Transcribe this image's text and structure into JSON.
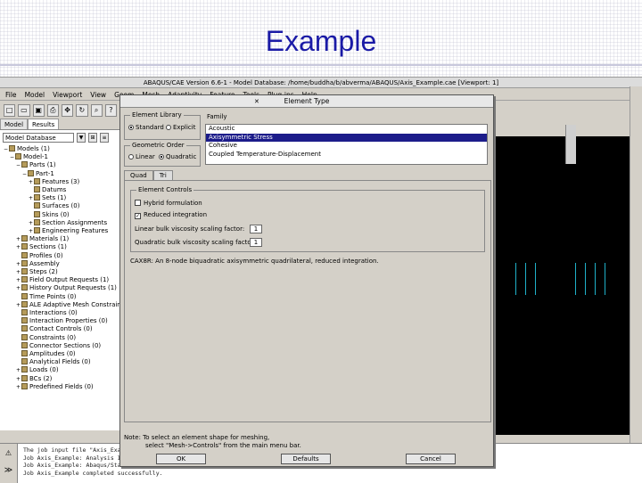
{
  "slide": {
    "title": "Example"
  },
  "app": {
    "window_title": "ABAQUS/CAE Version 6.6-1 - Model Database: /home/buddha/b/abverma/ABAQUS/Axis_Example.cae [Viewport: 1]",
    "menu": [
      "File",
      "Model",
      "Viewport",
      "View",
      "Geom",
      "Mesh",
      "Adaptivity",
      "Feature",
      "Tools",
      "Plug-ins",
      "Help"
    ],
    "toolbar_icons": [
      "new-icon",
      "open-icon",
      "save-icon",
      "print-icon",
      "move-icon",
      "rotate-icon",
      "zoom-icon",
      "query-icon"
    ],
    "tree_tabs": [
      "Model",
      "Results"
    ],
    "tree_combo": "Model Database",
    "tree": [
      {
        "label": "Models (1)",
        "indent": 0,
        "exp": "−"
      },
      {
        "label": "Model-1",
        "indent": 1,
        "exp": "−"
      },
      {
        "label": "Parts (1)",
        "indent": 2,
        "exp": "−"
      },
      {
        "label": "Part-1",
        "indent": 3,
        "exp": "−"
      },
      {
        "label": "Features (3)",
        "indent": 4,
        "exp": "+"
      },
      {
        "label": "Datums",
        "indent": 4,
        "exp": ""
      },
      {
        "label": "Sets (1)",
        "indent": 4,
        "exp": "+"
      },
      {
        "label": "Surfaces (0)",
        "indent": 4,
        "exp": ""
      },
      {
        "label": "Skins (0)",
        "indent": 4,
        "exp": ""
      },
      {
        "label": "Section Assignments",
        "indent": 4,
        "exp": "+"
      },
      {
        "label": "Engineering Features",
        "indent": 4,
        "exp": "+"
      },
      {
        "label": "Materials (1)",
        "indent": 2,
        "exp": "+"
      },
      {
        "label": "Sections (1)",
        "indent": 2,
        "exp": "+"
      },
      {
        "label": "Profiles (0)",
        "indent": 2,
        "exp": ""
      },
      {
        "label": "Assembly",
        "indent": 2,
        "exp": "+"
      },
      {
        "label": "Steps (2)",
        "indent": 2,
        "exp": "+"
      },
      {
        "label": "Field Output Requests (1)",
        "indent": 2,
        "exp": "+"
      },
      {
        "label": "History Output Requests (1)",
        "indent": 2,
        "exp": "+"
      },
      {
        "label": "Time Points (0)",
        "indent": 2,
        "exp": ""
      },
      {
        "label": "ALE Adaptive Mesh Constraints",
        "indent": 2,
        "exp": "+"
      },
      {
        "label": "Interactions (0)",
        "indent": 2,
        "exp": ""
      },
      {
        "label": "Interaction Properties (0)",
        "indent": 2,
        "exp": ""
      },
      {
        "label": "Contact Controls (0)",
        "indent": 2,
        "exp": ""
      },
      {
        "label": "Constraints (0)",
        "indent": 2,
        "exp": ""
      },
      {
        "label": "Connector Sections (0)",
        "indent": 2,
        "exp": ""
      },
      {
        "label": "Amplitudes (0)",
        "indent": 2,
        "exp": ""
      },
      {
        "label": "Analytical Fields (0)",
        "indent": 2,
        "exp": ""
      },
      {
        "label": "Loads (0)",
        "indent": 2,
        "exp": "+"
      },
      {
        "label": "BCs (2)",
        "indent": 2,
        "exp": "+"
      },
      {
        "label": "Predefined Fields (0)",
        "indent": 2,
        "exp": "+"
      }
    ],
    "messages": [
      "The job input file \"Axis_Example.inp\" has been submitted for analysis.",
      "Job Axis_Example: Analysis Input File Processor completed successfully.",
      "Job Axis_Example: Abaqus/Standard completed successfully.",
      "Job Axis_Example completed successfully."
    ],
    "prompt_symbol": "≫"
  },
  "dialog": {
    "title": "Element Type",
    "library": {
      "label": "Element Library",
      "options": [
        "Standard",
        "Explicit"
      ],
      "selected": "Standard"
    },
    "order": {
      "label": "Geometric Order",
      "options": [
        "Linear",
        "Quadratic"
      ],
      "selected": "Quadratic"
    },
    "family": {
      "label": "Family",
      "items": [
        "Acoustic",
        "Axisymmetric Stress",
        "Cohesive",
        "Coupled Temperature-Displacement"
      ],
      "selected": "Axisymmetric Stress"
    },
    "tabs": [
      "Quad",
      "Tri"
    ],
    "controls": {
      "label": "Element Controls",
      "hybrid": "Hybrid formulation",
      "reduced": "Reduced integration",
      "linear_scale_label": "Linear bulk viscosity scaling factor:",
      "linear_scale": "1",
      "quad_scale_label": "Quadratic bulk viscosity scaling factor:",
      "quad_scale": "1"
    },
    "description": "CAX8R: An 8-node biquadratic axisymmetric quadrilateral, reduced integration.",
    "note_line1": "Note: To select an element shape for meshing,",
    "note_line2": "select \"Mesh->Controls\" from the main menu bar.",
    "buttons": {
      "ok": "OK",
      "defaults": "Defaults",
      "cancel": "Cancel"
    }
  },
  "colors": {
    "title": "#1a1aa6",
    "selection": "#1c1c8a",
    "viewport_bg": "#000000",
    "mesh_lines": "#1fb0c8"
  }
}
